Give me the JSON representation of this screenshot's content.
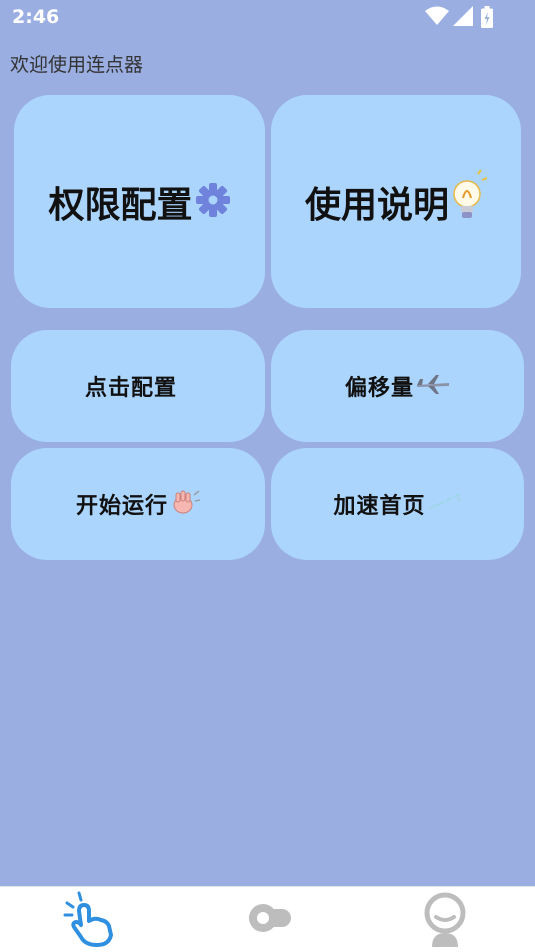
{
  "status_bar": {
    "time": "2:46",
    "icons": [
      "wifi-icon",
      "signal-icon",
      "battery-icon"
    ]
  },
  "greeting": "欢迎使用连点器",
  "tiles": [
    {
      "label": "权限配置",
      "icon": "gear-icon"
    },
    {
      "label": "使用说明",
      "icon": "lightbulb-icon"
    },
    {
      "label": "点击配置",
      "icon": ""
    },
    {
      "label": "偏移量",
      "icon": "airplane-icon"
    },
    {
      "label": "开始运行",
      "icon": "hand-icon"
    },
    {
      "label": "加速首页",
      "icon": "sparkle-icon"
    }
  ],
  "bottom_nav": {
    "items": [
      {
        "icon": "tap-hand-icon",
        "active": true
      },
      {
        "icon": "toggle-icon",
        "active": false
      },
      {
        "icon": "profile-icon",
        "active": false
      }
    ]
  },
  "colors": {
    "background": "#9aaee2",
    "tile": "#abd5fd",
    "nav_active": "#2f8fe0",
    "nav_inactive": "#bdbdbd"
  }
}
